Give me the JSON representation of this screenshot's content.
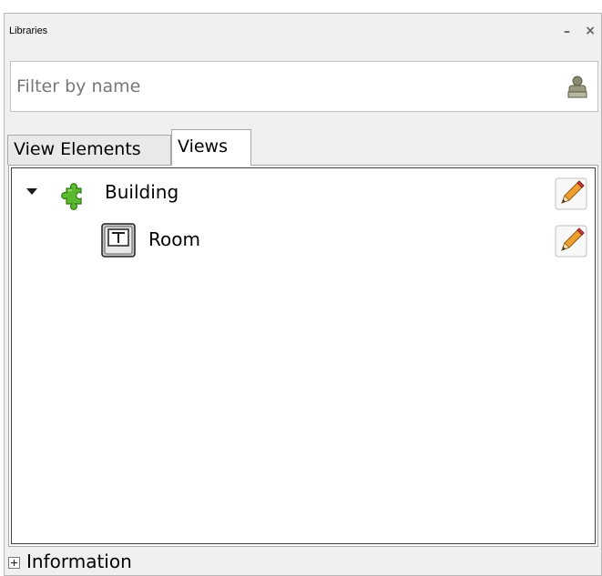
{
  "panel": {
    "title": "Libraries",
    "minimize_glyph": "–",
    "close_glyph": "×"
  },
  "filter": {
    "placeholder": "Filter by name",
    "value": ""
  },
  "tabs": [
    {
      "label": "View Elements",
      "active": false
    },
    {
      "label": "Views",
      "active": true
    }
  ],
  "tree": {
    "items": [
      {
        "label": "Building",
        "icon": "puzzle-piece-icon",
        "expanded": true,
        "level": 0
      },
      {
        "label": "Room",
        "icon": "text-frame-icon",
        "level": 1
      }
    ],
    "edit_icon": "pencil-edit-icon"
  },
  "info": {
    "label": "Information",
    "toggle_icon": "plus-box-icon"
  },
  "colors": {
    "panel_bg": "#f0f0f0",
    "puzzle_green": "#5cb82e",
    "pencil_orange": "#f0a030"
  }
}
